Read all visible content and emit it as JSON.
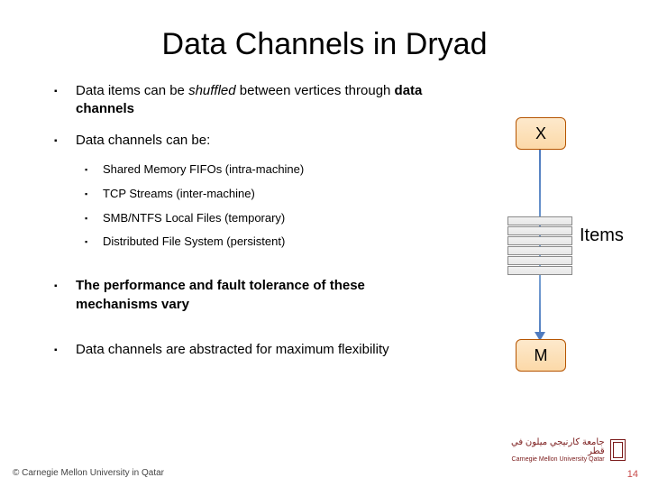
{
  "title": "Data Channels in Dryad",
  "bullets": {
    "b1_prefix": "Data items can be ",
    "b1_em": "shuffled",
    "b1_mid": " between vertices through ",
    "b1_strong": "data channels",
    "b2": "Data channels can be:",
    "sub1": "Shared Memory FIFOs (intra-machine)",
    "sub2": "TCP Streams (inter-machine)",
    "sub3": "SMB/NTFS Local Files (temporary)",
    "sub4": "Distributed File System (persistent)",
    "b3": "The performance and fault tolerance of these mechanisms vary",
    "b4": "Data channels are abstracted for maximum flexibility"
  },
  "diagram": {
    "top": "X",
    "bottom": "M",
    "label": "Items"
  },
  "footer": "© Carnegie Mellon University in Qatar",
  "page": "14",
  "logo_ar": "جامعة كارنيجي ميلون في قطر",
  "logo_en": "Carnegie Mellon University Qatar"
}
